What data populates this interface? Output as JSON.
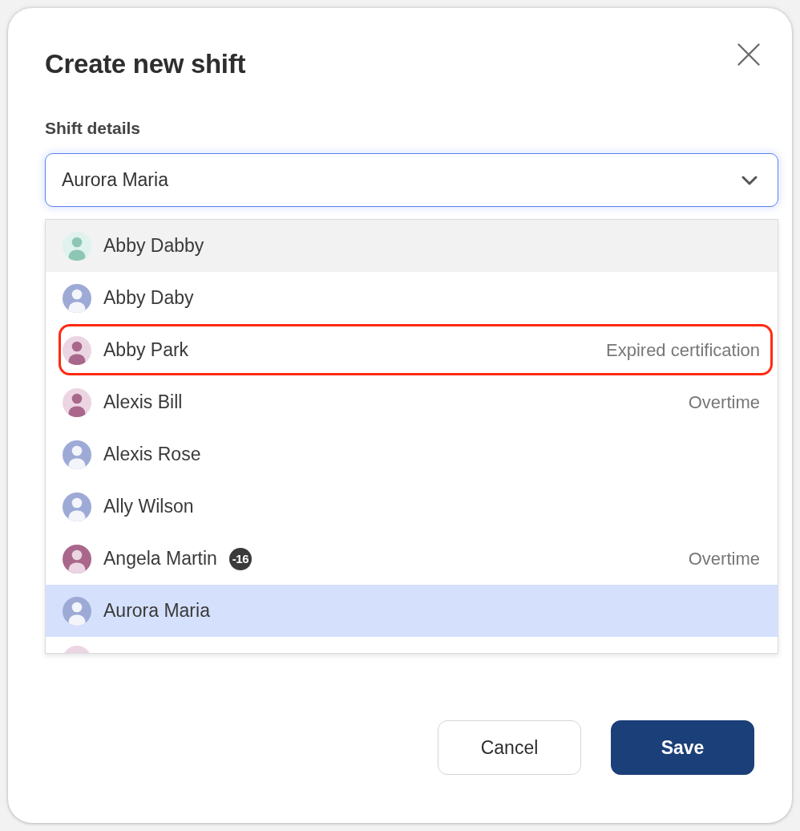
{
  "dialog": {
    "title": "Create new shift"
  },
  "shift_details": {
    "label": "Shift details",
    "select": {
      "value": "Aurora Maria",
      "expanded": true
    }
  },
  "dropdown": {
    "items": [
      {
        "name": "Abby Dabby",
        "avatar": {
          "color": "#e0f2ee",
          "figure": {
            "color": "#8ec6b6"
          }
        },
        "hovered": true,
        "selected": false,
        "flagged": false
      },
      {
        "name": "Abby Daby",
        "avatar": {
          "color": "#9eaad6",
          "figure": {
            "color": "#f3f5fb"
          }
        },
        "hovered": false,
        "selected": false,
        "flagged": false
      },
      {
        "name": "Abby Park",
        "avatar": {
          "color": "#ecd5e3",
          "figure": {
            "color": "#a9678b"
          }
        },
        "note": "Expired certification",
        "hovered": false,
        "selected": false,
        "flagged": true
      },
      {
        "name": "Alexis Bill",
        "avatar": {
          "color": "#ecd5e3",
          "figure": {
            "color": "#a9678b"
          }
        },
        "note": "Overtime",
        "hovered": false,
        "selected": false,
        "flagged": false
      },
      {
        "name": "Alexis Rose",
        "avatar": {
          "color": "#9eaad6",
          "figure": {
            "color": "#f3f5fb"
          }
        },
        "hovered": false,
        "selected": false,
        "flagged": false
      },
      {
        "name": "Ally Wilson",
        "avatar": {
          "color": "#9eaad6",
          "figure": {
            "color": "#f3f5fb"
          }
        },
        "hovered": false,
        "selected": false,
        "flagged": false
      },
      {
        "name": "Angela Martin",
        "avatar": {
          "color": "#a9678b",
          "figure": {
            "color": "#ecd5e3"
          }
        },
        "badge": "-16",
        "note": "Overtime",
        "hovered": false,
        "selected": false,
        "flagged": false
      },
      {
        "name": "Aurora Maria",
        "avatar": {
          "color": "#9eaad6",
          "figure": {
            "color": "#f3f5fb"
          }
        },
        "hovered": false,
        "selected": true,
        "flagged": false
      }
    ],
    "peek_item": {
      "avatar": {
        "color": "#ecd5e3"
      }
    }
  },
  "buttons": [
    {
      "label": "Cancel",
      "kind": "secondary"
    },
    {
      "label": "Save",
      "kind": "primary"
    }
  ]
}
